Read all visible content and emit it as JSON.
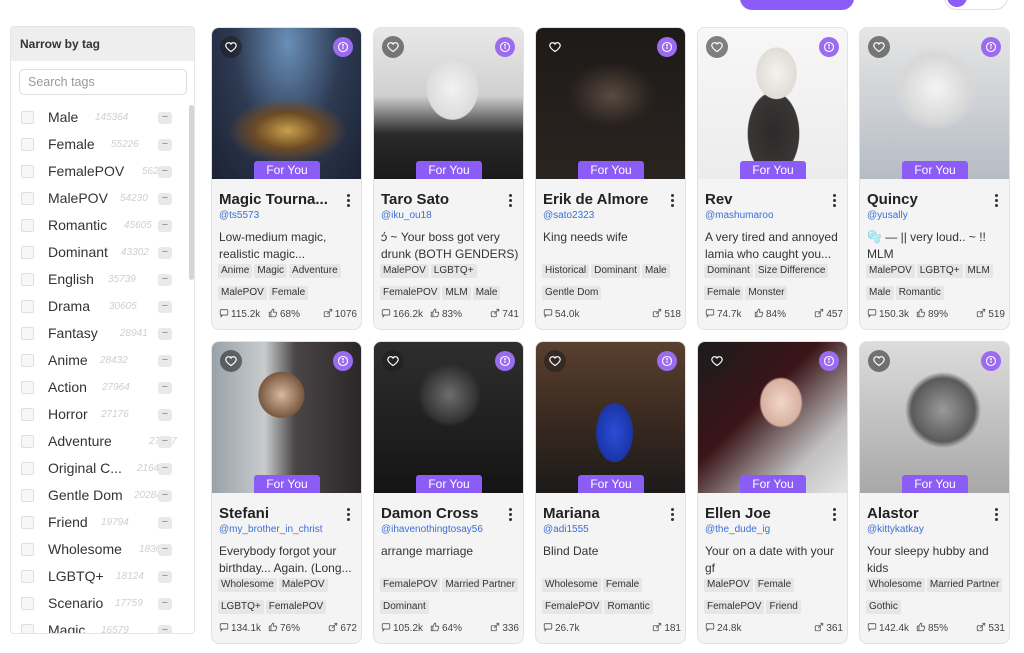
{
  "sidebar": {
    "title": "Narrow by tag",
    "search_placeholder": "Search tags",
    "tags": [
      {
        "name": "Male",
        "count": "145364"
      },
      {
        "name": "Female",
        "count": "55226"
      },
      {
        "name": "FemalePOV",
        "count": "56287"
      },
      {
        "name": "MalePOV",
        "count": "54230"
      },
      {
        "name": "Romantic",
        "count": "45605"
      },
      {
        "name": "Dominant",
        "count": "43302"
      },
      {
        "name": "English",
        "count": "35739"
      },
      {
        "name": "Drama",
        "count": "30605"
      },
      {
        "name": "Fantasy",
        "count": "28941"
      },
      {
        "name": "Anime",
        "count": "28432"
      },
      {
        "name": "Action",
        "count": "27964"
      },
      {
        "name": "Horror",
        "count": "27176"
      },
      {
        "name": "Adventure",
        "count": "27007"
      },
      {
        "name": "Original C...",
        "count": "21640"
      },
      {
        "name": "Gentle Dom",
        "count": "20284"
      },
      {
        "name": "Friend",
        "count": "19794"
      },
      {
        "name": "Wholesome",
        "count": "18365"
      },
      {
        "name": "LGBTQ+",
        "count": "18124"
      },
      {
        "name": "Scenario",
        "count": "17759"
      },
      {
        "name": "Magic",
        "count": "16579"
      }
    ]
  },
  "badge_label": "For You",
  "cards": [
    {
      "name": "Magic Tourna...",
      "handle": "@ts5573",
      "desc": "Low-medium magic, realistic magic...",
      "tags": [
        "Anime",
        "Magic",
        "Adventure",
        "MalePOV",
        "Female"
      ],
      "views": "115.2k",
      "rating": "68%",
      "likes": "1076",
      "img": "arena"
    },
    {
      "name": "Taro Sato",
      "handle": "@iku_ou18",
      "desc": "𖹷 ~ Your boss got very drunk (BOTH GENDERS)",
      "tags": [
        "MalePOV",
        "LGBTQ+",
        "FemalePOV",
        "MLM",
        "Male"
      ],
      "views": "166.2k",
      "rating": "83%",
      "likes": "741",
      "img": "sketch"
    },
    {
      "name": "Erik de Almore",
      "handle": "@sato2323",
      "desc": "King needs wife",
      "tags": [
        "Historical",
        "Dominant",
        "Male",
        "Gentle Dom"
      ],
      "views": "54.0k",
      "rating": "",
      "likes": "518",
      "img": "dark"
    },
    {
      "name": "Rev",
      "handle": "@mashumaroo",
      "desc": "A very tired and annoyed lamia who caught you...",
      "tags": [
        "Dominant",
        "Size Difference",
        "Female",
        "Monster"
      ],
      "views": "74.7k",
      "rating": "84%",
      "likes": "457",
      "img": "light"
    },
    {
      "name": "Quincy",
      "handle": "@yusally",
      "desc": "🫧 — || very loud.. ~ !! MLM",
      "tags": [
        "MalePOV",
        "LGBTQ+",
        "MLM",
        "Male",
        "Romantic"
      ],
      "views": "150.3k",
      "rating": "89%",
      "likes": "519",
      "img": "pale"
    },
    {
      "name": "Stefani",
      "handle": "@my_brother_in_christ",
      "desc": "Everybody forgot your birthday... Again. (Long...",
      "tags": [
        "Wholesome",
        "MalePOV",
        "LGBTQ+",
        "FemalePOV"
      ],
      "views": "134.1k",
      "rating": "76%",
      "likes": "672",
      "img": "room"
    },
    {
      "name": "Damon Cross",
      "handle": "@ihavenothingtosay56",
      "desc": "arrange marriage",
      "tags": [
        "FemalePOV",
        "Married Partner",
        "Dominant"
      ],
      "views": "105.2k",
      "rating": "64%",
      "likes": "336",
      "img": "noir"
    },
    {
      "name": "Mariana",
      "handle": "@adi1555",
      "desc": "Blind Date",
      "tags": [
        "Wholesome",
        "Female",
        "FemalePOV",
        "Romantic"
      ],
      "views": "26.7k",
      "rating": "",
      "likes": "181",
      "img": "bar"
    },
    {
      "name": "Ellen Joe",
      "handle": "@the_dude_ig",
      "desc": "Your on a date with your gf",
      "tags": [
        "MalePOV",
        "Female",
        "FemalePOV",
        "Friend"
      ],
      "views": "24.8k",
      "rating": "",
      "likes": "361",
      "img": "redblack"
    },
    {
      "name": "Alastor",
      "handle": "@kittykatkay",
      "desc": "Your sleepy hubby and kids",
      "tags": [
        "Wholesome",
        "Married Partner",
        "Gothic"
      ],
      "views": "142.4k",
      "rating": "85%",
      "likes": "531",
      "img": "grey"
    }
  ],
  "colors": {
    "accent": "#8b5cf6",
    "handle": "#3b6fd8"
  },
  "icons": [
    "heart-icon",
    "info-icon",
    "chat-icon",
    "thumbs-up-icon",
    "share-icon",
    "more-icon"
  ]
}
